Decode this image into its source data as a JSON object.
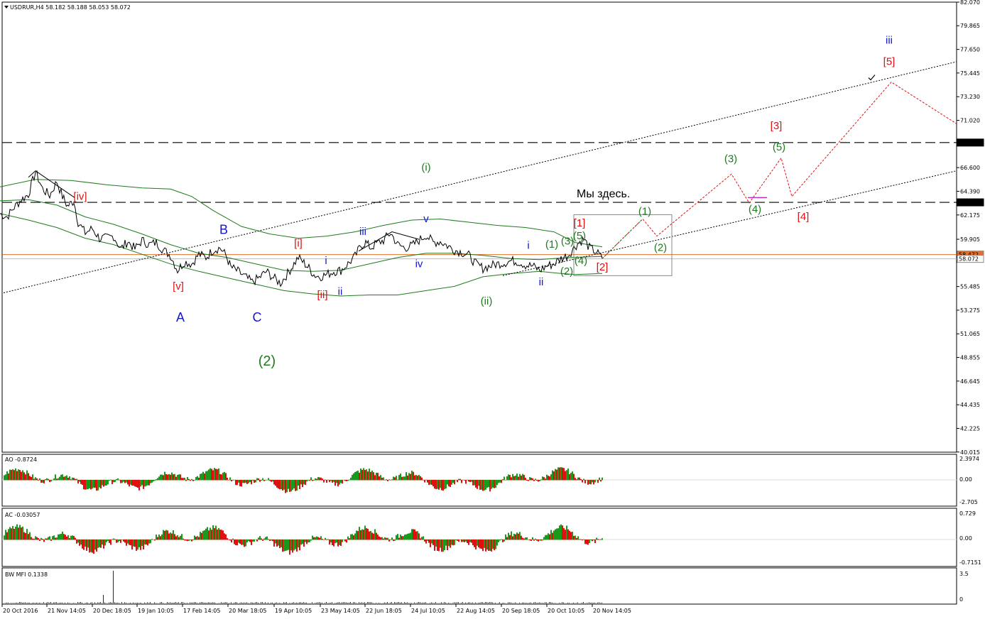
{
  "window": {
    "symbol_line": "USDRUR,H4  58.182 58.188 58.053 58.072",
    "note": "Мы здесь."
  },
  "indicators": {
    "ao": {
      "label": "AO -0.8724",
      "ticks": [
        "2.3974",
        "0.00",
        "-2.705"
      ]
    },
    "ac": {
      "label": "AC -0.03057",
      "ticks": [
        "0.729",
        "0.00",
        "-0.7151"
      ]
    },
    "mfi": {
      "label": "BW MFI 0.1338",
      "ticks": [
        "3.5",
        "0"
      ]
    }
  },
  "chart_data": {
    "type": "line",
    "symbol": "USDRUR",
    "timeframe": "H4",
    "ohlc_header": {
      "open": 58.182,
      "high": 58.188,
      "low": 58.053,
      "close": 58.072
    },
    "ylim": [
      40.0,
      82.07
    ],
    "price_ticks": [
      "82.070",
      "79.865",
      "77.650",
      "75.445",
      "73.230",
      "71.020",
      "68.943",
      "66.600",
      "64.390",
      "63.353",
      "62.175",
      "59.905",
      "58.072",
      "55.485",
      "53.275",
      "51.065",
      "48.855",
      "46.645",
      "44.435",
      "42.225",
      "40.015"
    ],
    "x_labels": [
      "20 Oct 2016",
      "21 Nov 14:05",
      "20 Dec 18:05",
      "19 Jan 10:05",
      "17 Feb 14:05",
      "20 Mar 18:05",
      "19 Apr 10:05",
      "23 May 14:05",
      "22 Jun 18:05",
      "24 Jul 10:05",
      "22 Aug 14:05",
      "20 Sep 18:05",
      "20 Oct 10:05",
      "20 Nov 14:05"
    ],
    "levels": [
      {
        "value": 68.943,
        "label": "68.943",
        "style": "dashed",
        "color": "#000000"
      },
      {
        "value": 63.353,
        "label": "63.353",
        "style": "dashed",
        "color": "#000000"
      },
      {
        "value": 58.472,
        "label": "58.472",
        "style": "solid",
        "color": "#e0702a"
      },
      {
        "value": 58.072,
        "label": "58.072",
        "style": "solid",
        "color": "#bbbbbb"
      }
    ],
    "price_series": [
      [
        0,
        62.3
      ],
      [
        10,
        62.0
      ],
      [
        20,
        62.9
      ],
      [
        30,
        63.6
      ],
      [
        40,
        64.1
      ],
      [
        50,
        66.2
      ],
      [
        60,
        64.6
      ],
      [
        70,
        64.0
      ],
      [
        80,
        65.3
      ],
      [
        88,
        63.9
      ],
      [
        95,
        63.0
      ],
      [
        104,
        63.5
      ],
      [
        110,
        61.5
      ],
      [
        120,
        60.5
      ],
      [
        130,
        60.9
      ],
      [
        140,
        60.0
      ],
      [
        150,
        60.0
      ],
      [
        160,
        60.2
      ],
      [
        170,
        59.0
      ],
      [
        180,
        59.7
      ],
      [
        190,
        59.0
      ],
      [
        200,
        59.8
      ],
      [
        210,
        59.4
      ],
      [
        220,
        59.6
      ],
      [
        230,
        58.9
      ],
      [
        240,
        58.4
      ],
      [
        250,
        57.0
      ],
      [
        260,
        57.8
      ],
      [
        270,
        57.6
      ],
      [
        280,
        58.5
      ],
      [
        290,
        58.2
      ],
      [
        300,
        58.9
      ],
      [
        310,
        59.1
      ],
      [
        318,
        58.4
      ],
      [
        325,
        57.3
      ],
      [
        335,
        56.9
      ],
      [
        345,
        56.4
      ],
      [
        355,
        55.9
      ],
      [
        365,
        56.3
      ],
      [
        375,
        56.9
      ],
      [
        385,
        56.3
      ],
      [
        395,
        55.8
      ],
      [
        405,
        56.7
      ],
      [
        412,
        57.4
      ],
      [
        420,
        58.2
      ],
      [
        428,
        57.7
      ],
      [
        435,
        57.2
      ],
      [
        442,
        56.6
      ],
      [
        450,
        56.4
      ],
      [
        460,
        56.6
      ],
      [
        470,
        56.9
      ],
      [
        480,
        57.0
      ],
      [
        490,
        57.6
      ],
      [
        500,
        58.3
      ],
      [
        508,
        59.3
      ],
      [
        515,
        59.6
      ],
      [
        522,
        59.1
      ],
      [
        530,
        59.5
      ],
      [
        540,
        59.8
      ],
      [
        550,
        60.5
      ],
      [
        560,
        59.4
      ],
      [
        570,
        59.1
      ],
      [
        580,
        59.3
      ],
      [
        590,
        59.8
      ],
      [
        600,
        60.3
      ],
      [
        610,
        59.6
      ],
      [
        620,
        59.7
      ],
      [
        630,
        59.3
      ],
      [
        640,
        58.9
      ],
      [
        650,
        58.7
      ],
      [
        660,
        58.4
      ],
      [
        670,
        57.6
      ],
      [
        680,
        57.2
      ],
      [
        690,
        57.4
      ],
      [
        700,
        57.6
      ],
      [
        710,
        57.7
      ],
      [
        720,
        57.9
      ],
      [
        730,
        57.8
      ],
      [
        740,
        57.5
      ],
      [
        750,
        57.4
      ],
      [
        760,
        57.0
      ],
      [
        770,
        57.4
      ],
      [
        780,
        57.6
      ],
      [
        790,
        58.1
      ],
      [
        800,
        58.4
      ],
      [
        808,
        59.1
      ],
      [
        815,
        59.6
      ],
      [
        822,
        59.9
      ],
      [
        830,
        59.1
      ],
      [
        840,
        58.7
      ],
      [
        848,
        58.1
      ]
    ],
    "channel_bands": {
      "upper": [
        [
          0,
          64.8
        ],
        [
          50,
          65.5
        ],
        [
          100,
          65.4
        ],
        [
          150,
          65.0
        ],
        [
          200,
          64.7
        ],
        [
          240,
          64.6
        ],
        [
          270,
          63.9
        ],
        [
          300,
          62.6
        ],
        [
          340,
          61.1
        ],
        [
          380,
          60.4
        ],
        [
          420,
          60.0
        ],
        [
          460,
          60.2
        ],
        [
          500,
          60.6
        ],
        [
          540,
          61.2
        ],
        [
          580,
          61.7
        ],
        [
          620,
          61.8
        ],
        [
          660,
          61.5
        ],
        [
          700,
          61.2
        ],
        [
          740,
          61.0
        ],
        [
          780,
          60.6
        ],
        [
          810,
          59.6
        ],
        [
          848,
          59.2
        ]
      ],
      "middle": [
        [
          0,
          63.5
        ],
        [
          40,
          63.6
        ],
        [
          80,
          63.1
        ],
        [
          120,
          62.0
        ],
        [
          160,
          61.3
        ],
        [
          200,
          60.4
        ],
        [
          240,
          59.4
        ],
        [
          280,
          58.6
        ],
        [
          320,
          58.2
        ],
        [
          360,
          57.6
        ],
        [
          400,
          57.0
        ],
        [
          440,
          56.9
        ],
        [
          480,
          57.0
        ],
        [
          520,
          57.6
        ],
        [
          560,
          58.2
        ],
        [
          600,
          58.6
        ],
        [
          640,
          58.6
        ],
        [
          680,
          58.4
        ],
        [
          720,
          58.1
        ],
        [
          760,
          58.0
        ],
        [
          800,
          58.2
        ],
        [
          848,
          58.3
        ]
      ],
      "lower": [
        [
          0,
          62.3
        ],
        [
          40,
          61.7
        ],
        [
          80,
          61.0
        ],
        [
          120,
          60.0
        ],
        [
          160,
          59.4
        ],
        [
          200,
          58.5
        ],
        [
          240,
          57.6
        ],
        [
          280,
          56.9
        ],
        [
          320,
          56.3
        ],
        [
          360,
          55.7
        ],
        [
          400,
          55.1
        ],
        [
          440,
          54.8
        ],
        [
          480,
          54.6
        ],
        [
          520,
          54.7
        ],
        [
          560,
          54.7
        ],
        [
          600,
          55.1
        ],
        [
          640,
          55.5
        ],
        [
          680,
          56.4
        ],
        [
          720,
          56.7
        ],
        [
          760,
          56.9
        ],
        [
          790,
          56.7
        ],
        [
          810,
          56.6
        ],
        [
          848,
          56.7
        ]
      ]
    },
    "trendlines": [
      {
        "style": "dotted",
        "points": [
          [
            5,
            54.9
          ],
          [
            1347,
            76.5
          ]
        ]
      },
      {
        "style": "dotted",
        "points": [
          [
            708,
            56.5
          ],
          [
            1347,
            66.3
          ]
        ]
      }
    ],
    "forecast_path": [
      [
        848,
        58.1
      ],
      [
        905,
        61.8
      ],
      [
        925,
        60.2
      ],
      [
        1030,
        66.0
      ],
      [
        1055,
        63.3
      ],
      [
        1100,
        67.5
      ],
      [
        1115,
        63.9
      ],
      [
        1255,
        74.6
      ],
      [
        1347,
        70.7
      ]
    ],
    "wave_labels": [
      {
        "text": "[iv]",
        "x": 113,
        "y": 63.6,
        "color": "#e01010"
      },
      {
        "text": "[v]",
        "x": 251,
        "y": 55.2,
        "color": "#e01010"
      },
      {
        "text": "A",
        "x": 254,
        "y": 52.2,
        "color": "#1515d0"
      },
      {
        "text": "B",
        "x": 315,
        "y": 60.4,
        "color": "#1515d0"
      },
      {
        "text": "C",
        "x": 362,
        "y": 52.2,
        "color": "#1515d0"
      },
      {
        "text": "(2)",
        "x": 376,
        "y": 48.1,
        "color": "#1f7a1f"
      },
      {
        "text": "[i]",
        "x": 420,
        "y": 59.2,
        "color": "#e01010"
      },
      {
        "text": "[ii]",
        "x": 454,
        "y": 54.4,
        "color": "#e01010"
      },
      {
        "text": "i",
        "x": 459,
        "y": 57.6,
        "color": "#1515d0"
      },
      {
        "text": "ii",
        "x": 479,
        "y": 54.7,
        "color": "#1515d0"
      },
      {
        "text": "iii",
        "x": 511,
        "y": 60.3,
        "color": "#1515d0"
      },
      {
        "text": "(i)",
        "x": 600,
        "y": 66.3,
        "color": "#1f7a1f"
      },
      {
        "text": "v",
        "x": 600,
        "y": 61.5,
        "color": "#1515d0"
      },
      {
        "text": "iv",
        "x": 590,
        "y": 57.3,
        "color": "#1515d0"
      },
      {
        "text": "(ii)",
        "x": 685,
        "y": 53.8,
        "color": "#1f7a1f"
      },
      {
        "text": "i",
        "x": 744,
        "y": 59.0,
        "color": "#1515d0"
      },
      {
        "text": "ii",
        "x": 762,
        "y": 55.6,
        "color": "#1515d0"
      },
      {
        "text": "(1)",
        "x": 777,
        "y": 59.1,
        "color": "#1f7a1f"
      },
      {
        "text": "(3)",
        "x": 799,
        "y": 59.4,
        "color": "#1f7a1f"
      },
      {
        "text": "(5)",
        "x": 816,
        "y": 59.9,
        "color": "#1f7a1f"
      },
      {
        "text": "(4)",
        "x": 818,
        "y": 57.6,
        "color": "#1f7a1f"
      },
      {
        "text": "(2)",
        "x": 798,
        "y": 56.6,
        "color": "#1f7a1f"
      },
      {
        "text": "[1]",
        "x": 816,
        "y": 61.1,
        "color": "#e01010"
      },
      {
        "text": "[2]",
        "x": 848,
        "y": 57.0,
        "color": "#e01010"
      },
      {
        "text": "(1)",
        "x": 908,
        "y": 62.2,
        "color": "#1f7a1f"
      },
      {
        "text": "(2)",
        "x": 930,
        "y": 58.8,
        "color": "#1f7a1f"
      },
      {
        "text": "(3)",
        "x": 1029,
        "y": 67.1,
        "color": "#1f7a1f"
      },
      {
        "text": "(4)",
        "x": 1063,
        "y": 62.4,
        "color": "#1f7a1f"
      },
      {
        "text": "(5)",
        "x": 1097,
        "y": 68.2,
        "color": "#1f7a1f"
      },
      {
        "text": "[3]",
        "x": 1093,
        "y": 70.2,
        "color": "#e01010"
      },
      {
        "text": "[4]",
        "x": 1131,
        "y": 61.7,
        "color": "#e01010"
      },
      {
        "text": "[5]",
        "x": 1252,
        "y": 76.2,
        "color": "#e01010"
      },
      {
        "text": "iii",
        "x": 1252,
        "y": 78.2,
        "color": "#1515d0"
      }
    ],
    "colors": {
      "price": "#000000",
      "bands": "#1f7a1f",
      "forecast": "#e01010",
      "support": "#e0702a",
      "osc_up": "#1a9a1a",
      "osc_down": "#e01010",
      "mfi": "#1515d0"
    }
  }
}
